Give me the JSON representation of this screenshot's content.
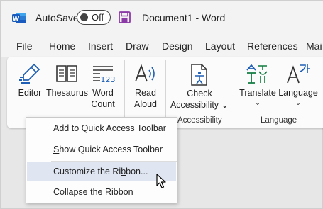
{
  "titlebar": {
    "autosave_label": "AutoSave",
    "toggle_state": "Off",
    "document_title": "Document1  -  Word",
    "colors": {
      "word_blue": "#185abd",
      "save_purple": "#8b3aa6"
    }
  },
  "tabs": [
    {
      "label": "File"
    },
    {
      "label": "Home"
    },
    {
      "label": "Insert"
    },
    {
      "label": "Draw"
    },
    {
      "label": "Design"
    },
    {
      "label": "Layout"
    },
    {
      "label": "References"
    },
    {
      "label": "Mai"
    }
  ],
  "ribbon": {
    "editor": {
      "label": "Editor"
    },
    "thesaurus": {
      "label": "Thesaurus"
    },
    "word_count": {
      "line1": "Word",
      "line2": "Count"
    },
    "read_aloud": {
      "line1": "Read",
      "line2": "Aloud"
    },
    "check_accessibility": {
      "line1": "Check",
      "line2": "Accessibility",
      "chevron": "⌄"
    },
    "accessibility_group": "Accessibility",
    "translate": {
      "label": "Translate",
      "chevron": "⌄"
    },
    "language": {
      "label": "Language",
      "chevron": "⌄"
    },
    "language_group": "Language",
    "count_icon_text": "123"
  },
  "context_menu": {
    "items": [
      {
        "label": "Add to Quick Access Toolbar",
        "underline_index": 0
      },
      {
        "label": "Show Quick Access Toolbar",
        "underline_index": 0
      },
      {
        "label": "Customize the Ribbon...",
        "underline_index": 16
      },
      {
        "label": "Collapse the Ribbon",
        "underline_index": 17
      }
    ],
    "highlighted_index": 2,
    "highlight_color": "#dfe6f1"
  }
}
